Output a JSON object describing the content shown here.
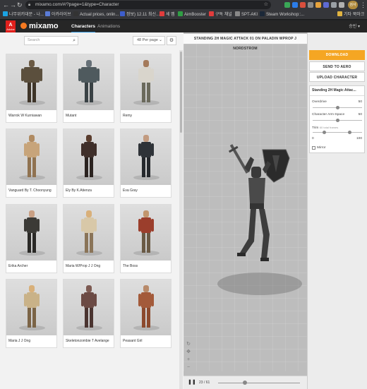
{
  "browser": {
    "url": "mixamo.com/#/?page=1&type=Character",
    "profile": "검사",
    "bookmarks": [
      {
        "label": "나무위키대문 - 나...",
        "color": "#1ba3e3"
      },
      {
        "label": "아카라이브",
        "color": "#5a7bd6"
      },
      {
        "label": "Actual prices, onlin...",
        "color": "#333333"
      },
      {
        "label": "정보) 12.11 최신...",
        "color": "#3d5dcb"
      },
      {
        "label": "세 맵",
        "color": "#e03c3c"
      },
      {
        "label": "AimBooster",
        "color": "#2f9e44"
      },
      {
        "label": "구독 채널",
        "color": "#e03c3c"
      },
      {
        "label": "SPT-AKI",
        "color": "#888888"
      },
      {
        "label": "Steam Workshop::...",
        "color": "#1b2838"
      },
      {
        "label": "기타 북마크",
        "color": "#e0b341"
      }
    ]
  },
  "mixamo": {
    "adobe": "Adobe",
    "logo": "mixamo",
    "tabs": {
      "characters": "Characters",
      "animations": "Animations"
    },
    "user": "승빈 ▾"
  },
  "left_panel": {
    "search_placeholder": "Search",
    "per_page": "48 Per page",
    "characters": [
      {
        "name": "Warrok W Kurniawan",
        "body": "#5b4f3d",
        "head": "#6b5a44",
        "legs": "#3e3428",
        "bulky": true
      },
      {
        "name": "Mutant",
        "body": "#4f5a5e",
        "head": "#667077",
        "legs": "#3a4245",
        "bulky": true
      },
      {
        "name": "Remy",
        "body": "#d9d5cc",
        "head": "#a47a5a",
        "legs": "#6b6a5c",
        "bulky": false
      },
      {
        "name": "Vanguard By T. Choonyung",
        "body": "#c7a47a",
        "head": "#b08b62",
        "legs": "#8f7250",
        "bulky": false
      },
      {
        "name": "Ely By K.Atienza",
        "body": "#3f2f2a",
        "head": "#5a3d2e",
        "legs": "#2b2320",
        "bulky": false
      },
      {
        "name": "Eva Gray",
        "body": "#2f3338",
        "head": "#c29b80",
        "legs": "#25282c",
        "bulky": false
      },
      {
        "name": "Erika Archer",
        "body": "#3b3a36",
        "head": "#c9a084",
        "legs": "#2a2926",
        "bulky": false
      },
      {
        "name": "Maria W/Prop J J Ong",
        "body": "#d8c8a8",
        "head": "#d9b07a",
        "legs": "#8a7458",
        "bulky": false
      },
      {
        "name": "The Boss",
        "body": "#9b3e2c",
        "head": "#c2966d",
        "legs": "#6a5a45",
        "bulky": false
      },
      {
        "name": "Maria J J Ong",
        "body": "#c9b288",
        "head": "#d8b07a",
        "legs": "#7b6446",
        "bulky": false
      },
      {
        "name": "Skeletonzombie T Avelange",
        "body": "#6b4a44",
        "head": "#7d5a52",
        "legs": "#4a3430",
        "bulky": false
      },
      {
        "name": "Peasant Girl",
        "body": "#a35a3a",
        "head": "#b88a6a",
        "legs": "#8c4a2e",
        "bulky": false
      }
    ]
  },
  "viewport": {
    "title": "STANDING 2H MAGIC ATTACK 01 ON PALADIN WPROP J NORDSTROM",
    "frame": "23 / 61",
    "playback_fraction": 0.33
  },
  "right_panel": {
    "download": "DOWNLOAD",
    "send_to_aero": "SEND TO AERO",
    "upload_character": "UPLOAD CHARACTER",
    "settings_title": "Standing 2H Magic Attac...",
    "overdrive": {
      "label": "Overdrive",
      "value": "50",
      "fraction": 0.5
    },
    "arm_space": {
      "label": "Character Arm-Space",
      "value": "50",
      "fraction": 0.5
    },
    "trim": {
      "label": "Trim",
      "note": "60 total frames",
      "min": "0",
      "max": "100",
      "start_fraction": 0.23,
      "end_fraction": 0.75
    },
    "mirror": "Mirror"
  }
}
